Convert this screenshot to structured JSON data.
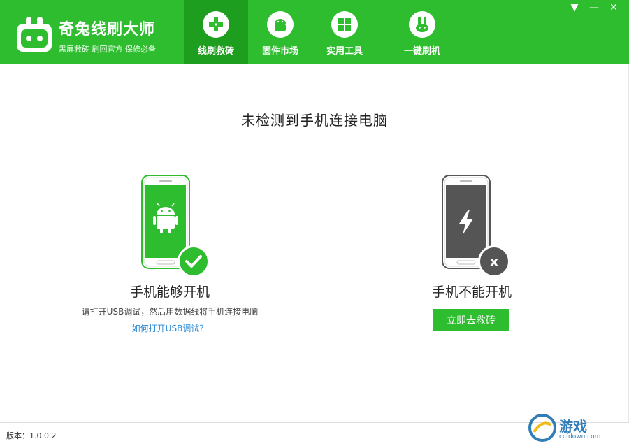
{
  "app": {
    "title": "奇兔线刷大师",
    "subtitle": "黑屏救砖  刷回官方  保修必备"
  },
  "nav": [
    {
      "label": "线刷救砖",
      "icon": "plus-cross-icon",
      "active": true
    },
    {
      "label": "固件市场",
      "icon": "android-icon",
      "active": false
    },
    {
      "label": "实用工具",
      "icon": "grid-icon",
      "active": false
    },
    {
      "label": "一键刷机",
      "icon": "rabbit-icon",
      "active": false
    }
  ],
  "window_controls": {
    "dropdown": "▼",
    "minimize": "—",
    "close": "✕"
  },
  "main": {
    "headline": "未检测到手机连接电脑",
    "left": {
      "title": "手机能够开机",
      "description": "请打开USB调试，然后用数据线将手机连接电脑",
      "link": "如何打开USB调试？"
    },
    "right": {
      "title": "手机不能开机",
      "button": "立即去救砖",
      "badge": "x"
    }
  },
  "footer": {
    "version": "版本：1.0.0.2"
  },
  "watermark": {
    "text": "游戏",
    "sub": "ccfdown.com"
  },
  "colors": {
    "brand_green": "#2ebd2e",
    "nav_active": "#1e9e1e",
    "link_blue": "#2a8ad6",
    "phone_dark": "#555555"
  }
}
